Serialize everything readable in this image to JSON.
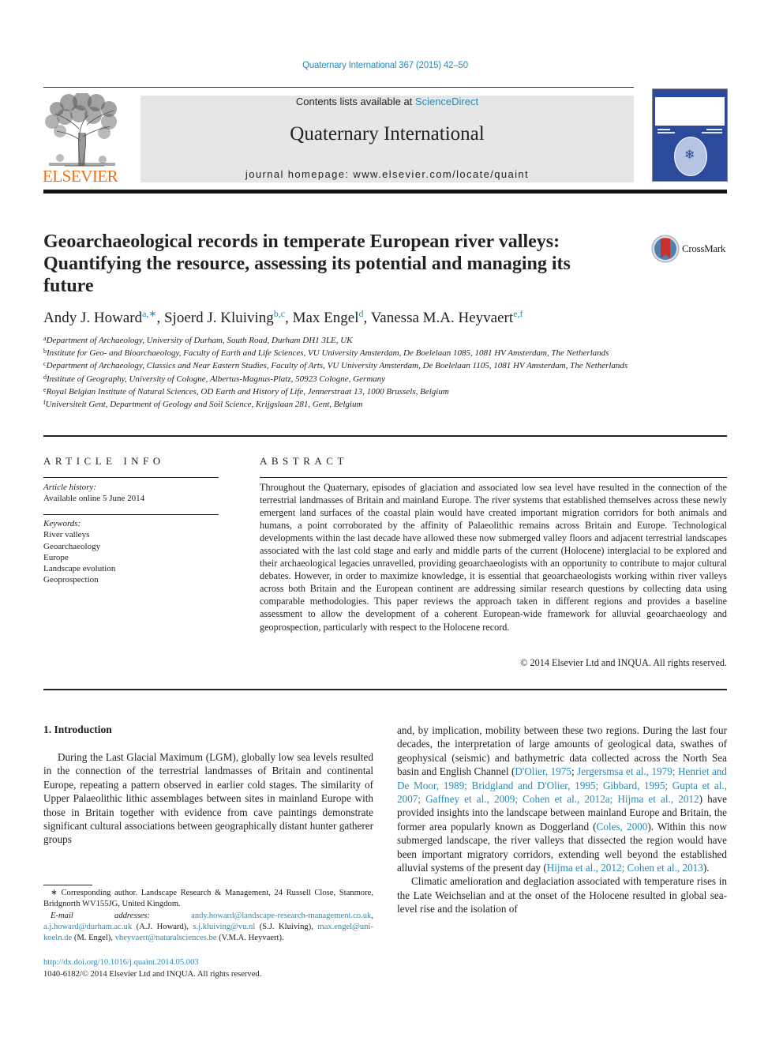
{
  "citation": "Quaternary International 367 (2015) 42–50",
  "header": {
    "publisher_word": "ELSEVIER",
    "contents_prefix": "Contents lists available at ",
    "contents_link": "ScienceDirect",
    "journal_title": "Quaternary International",
    "homepage_prefix": "journal homepage: ",
    "homepage_url": "www.elsevier.com/locate/quaint"
  },
  "crossmark_label": "CrossMark",
  "article": {
    "title_lines": [
      "Geoarchaeological records in temperate European river valleys:",
      "Quantifying the resource, assessing its potential and managing its",
      "future"
    ],
    "authors": [
      {
        "name": "Andy J. Howard",
        "sup": "a,∗",
        "sep": ", "
      },
      {
        "name": "Sjoerd J. Kluiving",
        "sup": "b,c",
        "sep": ", "
      },
      {
        "name": "Max Engel",
        "sup": "d",
        "sep": ", "
      },
      {
        "name": "Vanessa M.A. Heyvaert",
        "sup": "e,f",
        "sep": ""
      }
    ],
    "affiliations": [
      {
        "key": "a",
        "text": "Department of Archaeology, University of Durham, South Road, Durham DH1 3LE, UK"
      },
      {
        "key": "b",
        "text": "Institute for Geo- and Bioarchaeology, Faculty of Earth and Life Sciences, VU University Amsterdam, De Boelelaan 1085, 1081 HV Amsterdam, The Netherlands"
      },
      {
        "key": "c",
        "text": "Department of Archaeology, Classics and Near Eastern Studies, Faculty of Arts, VU University Amsterdam, De Boelelaan 1105, 1081 HV Amsterdam, The Netherlands"
      },
      {
        "key": "d",
        "text": "Institute of Geography, University of Cologne, Albertus-Magnus-Platz, 50923 Cologne, Germany"
      },
      {
        "key": "e",
        "text": "Royal Belgian Institute of Natural Sciences, OD Earth and History of Life, Jennerstraat 13, 1000 Brussels, Belgium"
      },
      {
        "key": "f",
        "text": "Universiteit Gent, Department of Geology and Soil Science, Krijgslaan 281, Gent, Belgium"
      }
    ]
  },
  "article_info": {
    "heading": "ARTICLE INFO",
    "history_label": "Article history:",
    "history_value": "Available online 5 June 2014",
    "keywords_label": "Keywords:",
    "keywords": [
      "River valleys",
      "Geoarchaeology",
      "Europe",
      "Landscape evolution",
      "Geoprospection"
    ]
  },
  "abstract": {
    "heading": "ABSTRACT",
    "text": "Throughout the Quaternary, episodes of glaciation and associated low sea level have resulted in the connection of the terrestrial landmasses of Britain and mainland Europe. The river systems that estab­lished themselves across these newly emergent land surfaces of the coastal plain would have created important migration corridors for both animals and humans, a point corroborated by the affinity of Palaeolithic remains across Britain and Europe. Technological developments within the last decade have allowed these now submerged valley floors and adjacent terrestrial landscapes associated with the last cold stage and early and middle parts of the current (Holocene) interglacial to be explored and their archaeological legacies unravelled, providing geoarchaeologists with an opportunity to contribute to major cultural debates. However, in order to maximize knowledge, it is essential that geoarchaeologists working within river valleys across both Britain and the European continent are addressing similar research questions by collecting data using comparable methodologies. This paper reviews the approach taken in different regions and provides a baseline assessment to allow the development of a coherent European-wide framework for alluvial geoarchaeology and geoprospection, particularly with respect to the Holocene record.",
    "copyright": "© 2014 Elsevier Ltd and INQUA. All rights reserved."
  },
  "introduction": {
    "heading": "1.  Introduction",
    "left_paragraph": "During the Last Glacial Maximum (LGM), globally low sea levels resulted in the connection of the terrestrial landmasses of Britain and continental Europe, repeating a pattern observed in earlier cold stages. The similarity of Upper Palaeolithic lithic assemblages be­tween sites in mainland Europe with those in Britain together with evidence from cave paintings demonstrate significant cultural as­sociations between geographically distant hunter gatherer groups",
    "right_p1_a": "and, by implication, mobility between these two regions. During the last four decades, the interpretation of large amounts of geological data, swathes of geophysical (seismic) and bathymetric data collected across the North Sea basin and English Channel (",
    "refs_1": [
      "D'Olier, 1975",
      "Jergersmsa et al., 1979; Henriet and De Moor, 1989; Bridgland and D'Olier, 1995; Gibbard, 1995; Gupta et al., 2007; Gaffney et al., 2009; Cohen et al., 2012a; Hijma et al., 2012"
    ],
    "refs_1_sep": "; ",
    "right_p1_b": ") have provided insights into the landscape between mainland Europe and Britain, the former area popularly known as Doggerland (",
    "ref_coles": "Coles, 2000",
    "right_p1_c": "). Within this now submerged landscape, the river valleys that dissected the region would have been important migratory corridors, extending well beyond the established alluvial systems of the present day (",
    "ref_hijma": "Hijma et al., 2012; Cohen et al., 2013",
    "right_p1_d": ").",
    "right_p2": "Climatic amelioration and deglaciation associated with tem­perature rises in the Late Weichselian and at the onset of the Ho­locene resulted in global sea-level rise and the isolation of"
  },
  "footnotes": {
    "corresponding": "∗ Corresponding author. Landscape Research & Management, 24 Russell Close, Stanmore, Bridgnorth WV155JG, United Kingdom.",
    "email_label": "E-mail addresses:",
    "emails": [
      {
        "address": "andy.howard@landscape-research-management.co.uk",
        "after": ", "
      },
      {
        "address": "a.j.howard@durham.ac.uk",
        "after": " (A.J. Howard), "
      },
      {
        "address": "s.j.kluiving@vu.nl",
        "after": " (S.J. Kluiving), "
      },
      {
        "address": "max.engel@uni-koeln.de",
        "after": " (M. Engel), "
      },
      {
        "address": "vheyvaert@naturalsciences.be",
        "after": " (V.M.A. Heyvaert)."
      }
    ]
  },
  "doi": "http://dx.doi.org/10.1016/j.quaint.2014.05.003",
  "issn_line": "1040-6182/© 2014 Elsevier Ltd and INQUA. All rights reserved.",
  "colors": {
    "link": "#2a8ab8",
    "elsevier_orange": "#e9711c",
    "header_box": "#e6e6e6",
    "cover_blue": "#2c4a9c",
    "crossmark_red": "#c8322a"
  }
}
